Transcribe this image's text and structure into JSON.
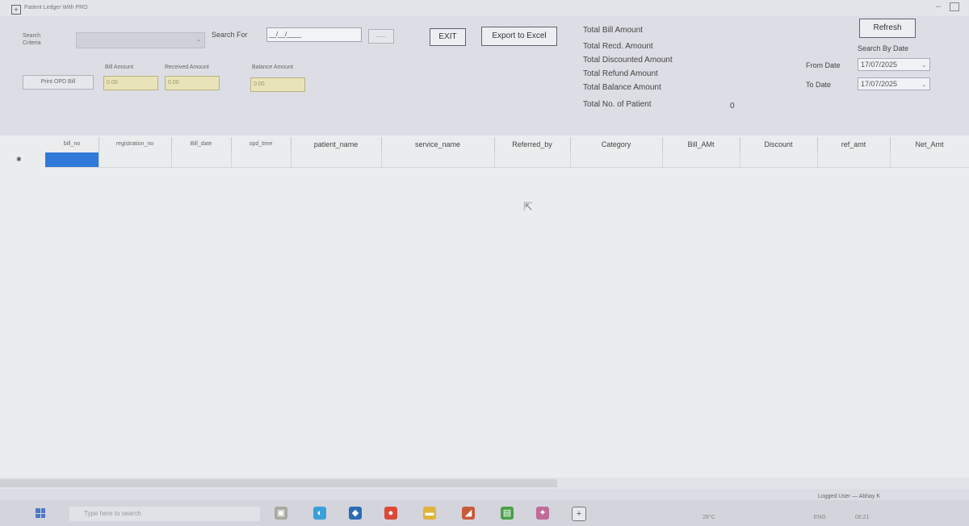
{
  "window": {
    "title": "Patient Ledger With PRO"
  },
  "search": {
    "criteria_label": "Search Criteria",
    "criteria_value": "",
    "search_for_label": "Search For",
    "search_for_value": "__/__/____",
    "browse_label": "......"
  },
  "summary": {
    "bill_amount_label": "Bill Amount",
    "bill_amount_value": "0.00",
    "received_amount_label": "Received Amount",
    "received_amount_value": "0.00",
    "balance_amount_label": "Balance Amount",
    "balance_amount_value": "0.00"
  },
  "buttons": {
    "print_opd": "Print OPD Bill",
    "exit": "EXIT",
    "export": "Export to Excel",
    "refresh": "Refresh"
  },
  "totals": {
    "bill": "Total Bill Amount",
    "recd": "Total Recd. Amount",
    "discounted": "Total Discounted Amount",
    "refund": "Total Refund Amount",
    "balance": "Total Balance Amount",
    "patients_label": "Total No. of Patient",
    "patients_value": "0"
  },
  "date_filter": {
    "label": "Search By Date",
    "from_label": "From Date",
    "from_value": "17/07/2025",
    "to_label": "To Date",
    "to_value": "17/07/2025"
  },
  "grid": {
    "columns": [
      "bill_no",
      "registration_no",
      "Bill_date",
      "opd_time",
      "patient_name",
      "service_name",
      "Referred_by",
      "Category",
      "Bill_AMt",
      "Discount",
      "ref_amt",
      "Net_Amt"
    ]
  },
  "status": {
    "logged_user": "Logged User — Abhay K"
  },
  "taskbar": {
    "search_placeholder": "Type here to search",
    "weather": "28°C",
    "lang": "ENG",
    "time": "08:21"
  },
  "colors": {
    "selection": "#2f7ad8",
    "yellow_box": "#e8e3b8"
  }
}
